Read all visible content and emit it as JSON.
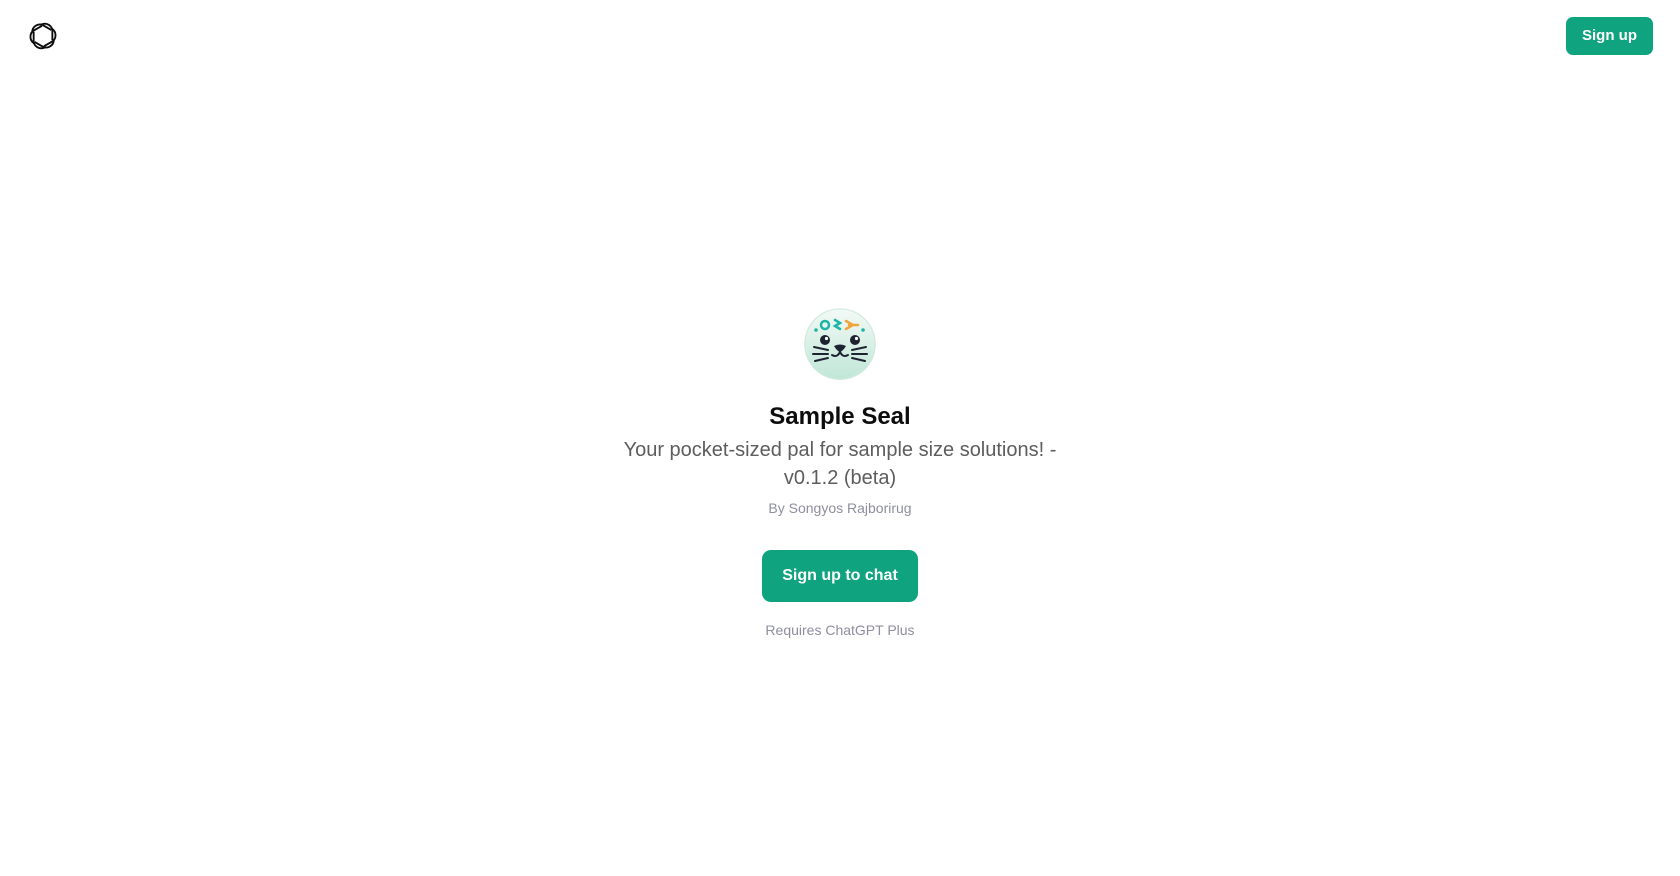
{
  "header": {
    "logo_icon": "openai-logo-icon",
    "signup_label": "Sign up"
  },
  "gpt": {
    "avatar_icon": "seal-avatar-icon",
    "name": "Sample Seal",
    "description": "Your pocket-sized pal for sample size solutions! - v0.1.2 (beta)",
    "author": "By Songyos Rajborirug"
  },
  "actions": {
    "chat_label": "Sign up to chat",
    "requirement_note": "Requires ChatGPT Plus"
  },
  "colors": {
    "accent": "#10a37f",
    "text_primary": "#0d0d0d",
    "text_secondary": "#5d5d5d",
    "text_muted": "#8e8ea0",
    "background": "#ffffff"
  }
}
